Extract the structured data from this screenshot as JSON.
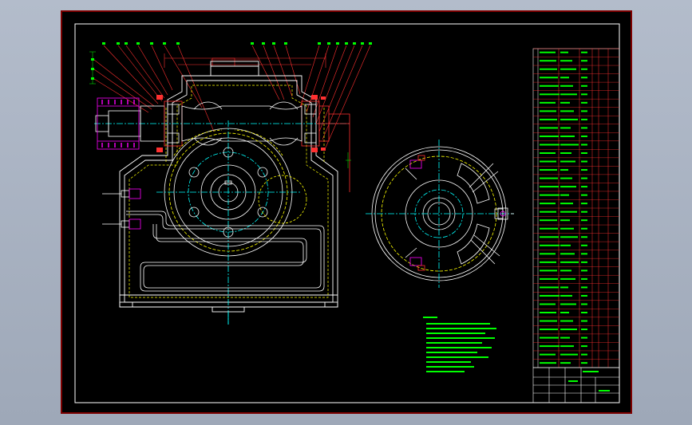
{
  "viewport": {
    "background": "#a9b3c2"
  },
  "drawing": {
    "sheet_background": "#000000",
    "frame_color": "#ffffff",
    "outer_border_color": "#7d0000",
    "accent_colors": {
      "housing": "#ffffff",
      "centerline": "#00ffff",
      "hidden": "#ffff00",
      "section": "#ff0000",
      "dimension": "#00ff00",
      "parts": "#ff00ff"
    },
    "left_view": {
      "name": "front-section-view"
    },
    "right_view": {
      "name": "side-view-wheel"
    },
    "notes_block": {
      "color": "#00ff00"
    },
    "parts_list": {
      "rows": 38,
      "color": "#00ff00"
    },
    "title_block": {
      "color": "#ffffff"
    }
  }
}
